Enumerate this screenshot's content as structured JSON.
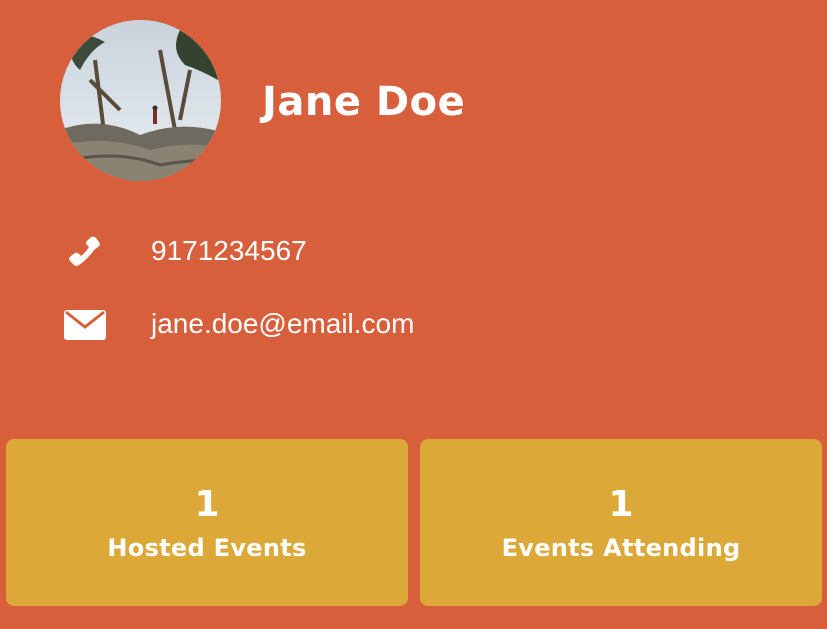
{
  "profile": {
    "name": "Jane Doe",
    "avatar_icon": "profile-photo"
  },
  "contact": {
    "phone": {
      "icon": "phone-icon",
      "value": "9171234567"
    },
    "email": {
      "icon": "envelope-icon",
      "value": "jane.doe@email.com"
    }
  },
  "stats": {
    "hosted": {
      "count": "1",
      "label": "Hosted Events"
    },
    "attending": {
      "count": "1",
      "label": "Events Attending"
    }
  },
  "colors": {
    "background": "#D85F3B",
    "card": "#DCA838",
    "text": "#FFFFFF"
  }
}
